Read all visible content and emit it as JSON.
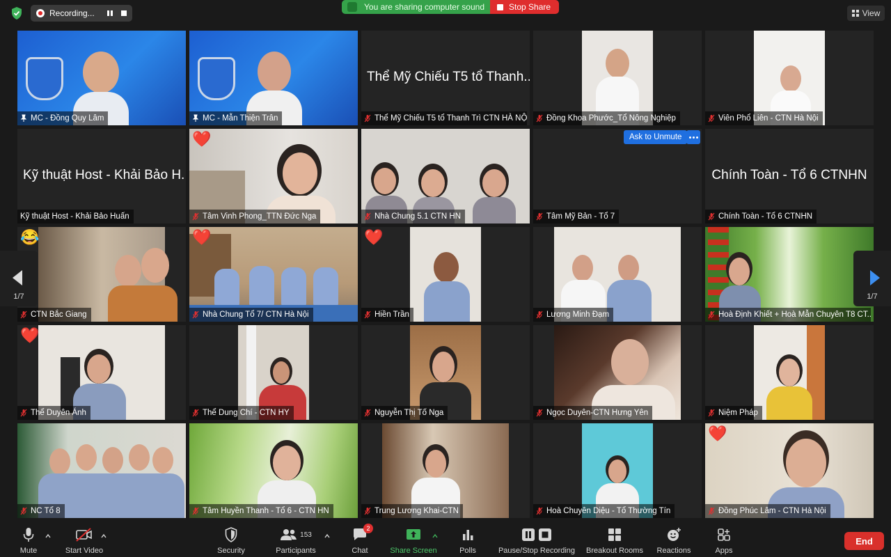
{
  "topbar": {
    "recording_label": "Recording...",
    "share_sound_text": "You are sharing computer sound",
    "stop_share_label": "Stop Share",
    "view_label": "View"
  },
  "pagination": {
    "left_page": "1/7",
    "right_page": "1/7"
  },
  "tiles": [
    {
      "name": "MC - Đồng Quy Lâm",
      "pinned": true
    },
    {
      "name": "MC - Mẫn Thiện Trân",
      "pinned": true
    },
    {
      "name": "Thể Mỹ Chiếu T5 tổ Thanh Trì CTN HÀ NỘI",
      "center": "Thể Mỹ Chiếu T5 tổ Thanh..."
    },
    {
      "name": "Đồng Khoa Phước_Tổ Nông Nghiệp"
    },
    {
      "name": "Viên Phổ Liên - CTN Hà Nội"
    },
    {
      "name": "Kỹ thuật Host - Khải Bảo Huấn",
      "center": "Kỹ thuật Host - Khải Bảo H..."
    },
    {
      "name": "Tâm Vinh Phong_TTN Đức Nga",
      "reaction": "❤️"
    },
    {
      "name": "Nhà Chung 5.1 CTN HN"
    },
    {
      "name": "Tâm Mỹ Bản - Tổ 7",
      "ask_unmute": "Ask to Unmute"
    },
    {
      "name": "Chính Toàn - Tổ 6 CTNHN",
      "center": "Chính Toàn - Tổ 6 CTNHN"
    },
    {
      "name": "CTN Bắc Giang",
      "reaction": "😂"
    },
    {
      "name": "Nhà Chung Tổ 7/ CTN Hà Nội",
      "reaction": "❤️"
    },
    {
      "name": "Hiền Trần",
      "reaction": "❤️"
    },
    {
      "name": "Lương Minh Đạm"
    },
    {
      "name": "Hoà Định Khiết + Hoà Mẫn Chuyên T8 CT..."
    },
    {
      "name": "Thể Duyên Ánh",
      "reaction": "❤️"
    },
    {
      "name": "Thể Dung Chí - CTN HY"
    },
    {
      "name": "Nguyễn Thị Tố Nga"
    },
    {
      "name": "Ngọc Duyên-CTN Hưng Yên"
    },
    {
      "name": "Niệm Pháp"
    },
    {
      "name": "NC Tổ 8"
    },
    {
      "name": "Tâm Huyền Thanh - Tổ 6 - CTN HN"
    },
    {
      "name": "Trung Lương Khai-CTN"
    },
    {
      "name": "Hoà Chuyên Diệu - Tổ Thường Tín"
    },
    {
      "name": "Đồng Phúc Lâm - CTN Hà Nội",
      "reaction": "❤️"
    }
  ],
  "toolbar": {
    "mute": "Mute",
    "start_video": "Start Video",
    "security": "Security",
    "participants": "Participants",
    "participants_count": "153",
    "chat": "Chat",
    "chat_badge": "2",
    "share_screen": "Share Screen",
    "polls": "Polls",
    "pause_stop_recording": "Pause/Stop Recording",
    "breakout_rooms": "Breakout Rooms",
    "reactions": "Reactions",
    "apps": "Apps",
    "end": "End"
  },
  "colors": {
    "accent_green": "#35a24a",
    "stop_red": "#df2d2d",
    "active_speaker": "#e8e26a",
    "ask_unmute_blue": "#1f6fe0",
    "end_red": "#d9302b"
  }
}
